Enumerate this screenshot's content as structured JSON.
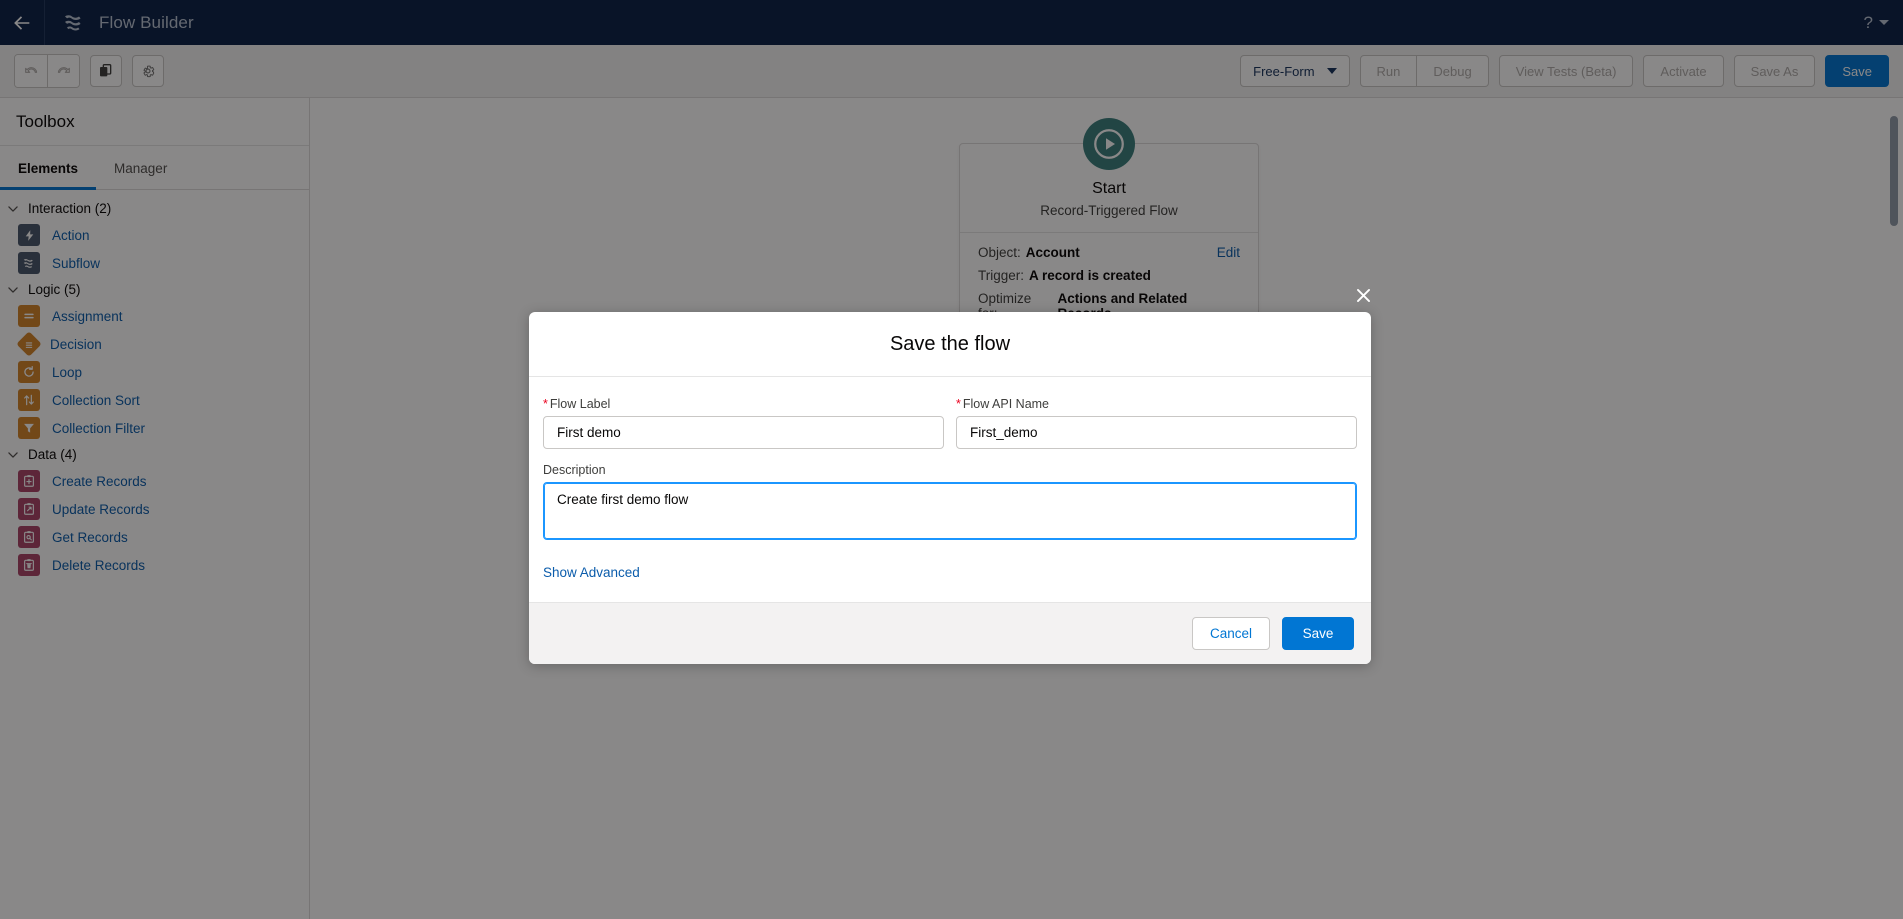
{
  "global_header": {
    "back_icon": "arrow-left-icon",
    "logo_icon": "flow-builder-logo-icon",
    "title": "Flow Builder",
    "help_icon": "question-mark-icon",
    "help_caret_icon": "chevron-down-icon"
  },
  "toolbar": {
    "undo_icon": "undo-icon",
    "redo_icon": "redo-icon",
    "copy_icon": "copy-icon",
    "settings_icon": "gear-icon",
    "canvas_mode": "Free-Form",
    "canvas_mode_caret": "chevron-down-icon",
    "run_label": "Run",
    "debug_label": "Debug",
    "view_tests_label": "View Tests (Beta)",
    "activate_label": "Activate",
    "save_as_label": "Save As",
    "save_label": "Save",
    "brand_color": "#0176d3"
  },
  "toolbox": {
    "title": "Toolbox",
    "tabs": [
      {
        "label": "Elements",
        "active": true
      },
      {
        "label": "Manager",
        "active": false
      }
    ],
    "groups": [
      {
        "name": "Interaction (2)",
        "chevron": "chevron-down-icon",
        "items": [
          {
            "label": "Action",
            "icon": "lightning-bolt-icon",
            "color": "#47566b"
          },
          {
            "label": "Subflow",
            "icon": "subflow-icon",
            "color": "#47566b"
          }
        ]
      },
      {
        "name": "Logic (5)",
        "chevron": "chevron-down-icon",
        "items": [
          {
            "label": "Assignment",
            "icon": "assignment-icon",
            "color": "#d4852a"
          },
          {
            "label": "Decision",
            "icon": "decision-icon",
            "color": "#d4852a"
          },
          {
            "label": "Loop",
            "icon": "loop-icon",
            "color": "#d4852a"
          },
          {
            "label": "Collection Sort",
            "icon": "sort-arrows-icon",
            "color": "#d4852a"
          },
          {
            "label": "Collection Filter",
            "icon": "funnel-icon",
            "color": "#d4852a"
          }
        ]
      },
      {
        "name": "Data (4)",
        "chevron": "chevron-down-icon",
        "items": [
          {
            "label": "Create Records",
            "icon": "record-create-icon",
            "color": "#ab4369"
          },
          {
            "label": "Update Records",
            "icon": "record-update-icon",
            "color": "#ab4369"
          },
          {
            "label": "Get Records",
            "icon": "record-get-icon",
            "color": "#ab4369"
          },
          {
            "label": "Delete Records",
            "icon": "record-delete-icon",
            "color": "#ab4369"
          }
        ]
      }
    ]
  },
  "canvas": {
    "start_node": {
      "play_icon": "play-icon",
      "badge_color": "#3a7f7e",
      "title": "Start",
      "subtitle": "Record-Triggered Flow",
      "edit_label": "Edit",
      "rows": [
        {
          "label": "Object:",
          "value": "Account"
        },
        {
          "label": "Trigger:",
          "value": "A record is created"
        },
        {
          "label": "Optimize for:",
          "value": "Actions and Related Records"
        }
      ]
    }
  },
  "modal": {
    "close_icon": "close-icon",
    "title": "Save the flow",
    "flow_label": {
      "label": "Flow Label",
      "required_marker": "*",
      "value": "First demo",
      "placeholder": ""
    },
    "flow_api_name": {
      "label": "Flow API Name",
      "required_marker": "*",
      "value": "First_demo",
      "placeholder": ""
    },
    "description": {
      "label": "Description",
      "value": "Create first demo flow",
      "placeholder": ""
    },
    "show_advanced_label": "Show Advanced",
    "cancel_label": "Cancel",
    "save_label": "Save"
  }
}
